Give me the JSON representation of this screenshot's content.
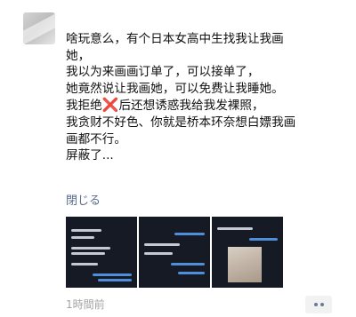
{
  "post": {
    "lines": [
      "啥玩意么，有个日本女高中生找我让我画",
      "她，",
      "我以为来画画订单了，可以接单了，",
      "她竟然说让我画她，可以免费让我睡她。",
      "我拒绝",
      "❌",
      "后还想诱惑我给我发裸照，",
      "我贪财不好色、你就是桥本环奈想白嫖我画",
      "画都不行。",
      "屏蔽了..."
    ]
  },
  "collapse_label": "閉じる",
  "timestamp": "1時間前",
  "icons": {
    "avatar": "blurred-avatar",
    "more": "more-dots-icon"
  },
  "colors": {
    "link": "#5b6b8e",
    "text": "#111111",
    "muted": "#a3a3a3",
    "x_mark": "#d81e28"
  }
}
